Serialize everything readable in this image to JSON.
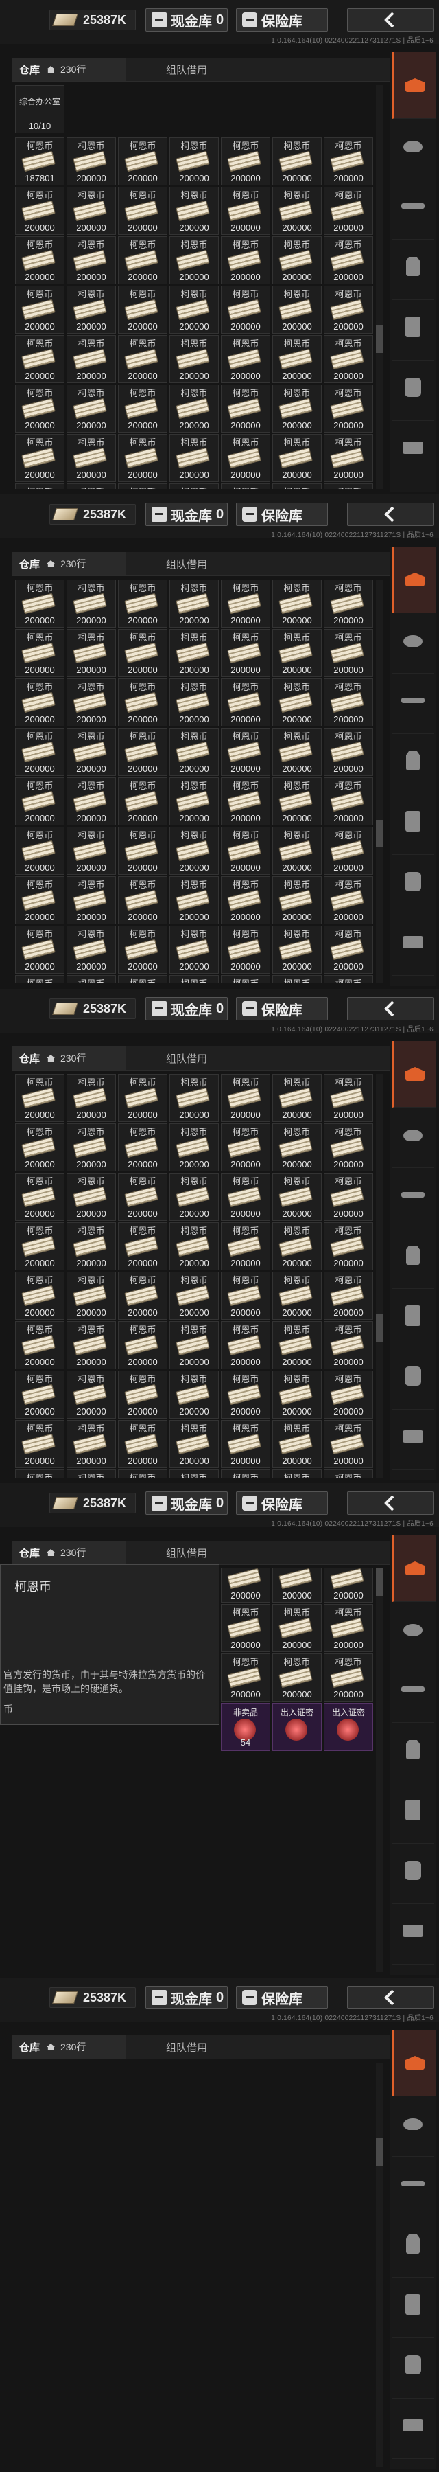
{
  "topbar": {
    "money": "25387K",
    "cash_label": "现金库",
    "cash_count": "0",
    "safe_label": "保险库",
    "meta": "1.0.164.164(10) 022400221127311271S | 品质1~6"
  },
  "tabs": {
    "warehouse": "仓库",
    "capacity": "230行",
    "team": "组队借用"
  },
  "sidebar": [
    "warehouse-icon",
    "helmet-icon",
    "gun-icon",
    "armor-icon",
    "vest-icon",
    "bag-icon",
    "toolbox-icon"
  ],
  "item": {
    "name": "柯恩币",
    "amount": "200000"
  },
  "screen1": {
    "office_label": "综合办公室",
    "office_count": "10/10",
    "first_amount": "187801"
  },
  "tooltip": {
    "title": "柯恩币",
    "desc": "官方发行的货币，由于其与特殊拉货方货币的价值挂钩，是市场上的硬通货。",
    "foot": "币"
  },
  "specials": [
    {
      "name": "非卖品",
      "count": "54"
    },
    {
      "name": "出入证密",
      "count": ""
    },
    {
      "name": "出入证密",
      "count": ""
    }
  ]
}
